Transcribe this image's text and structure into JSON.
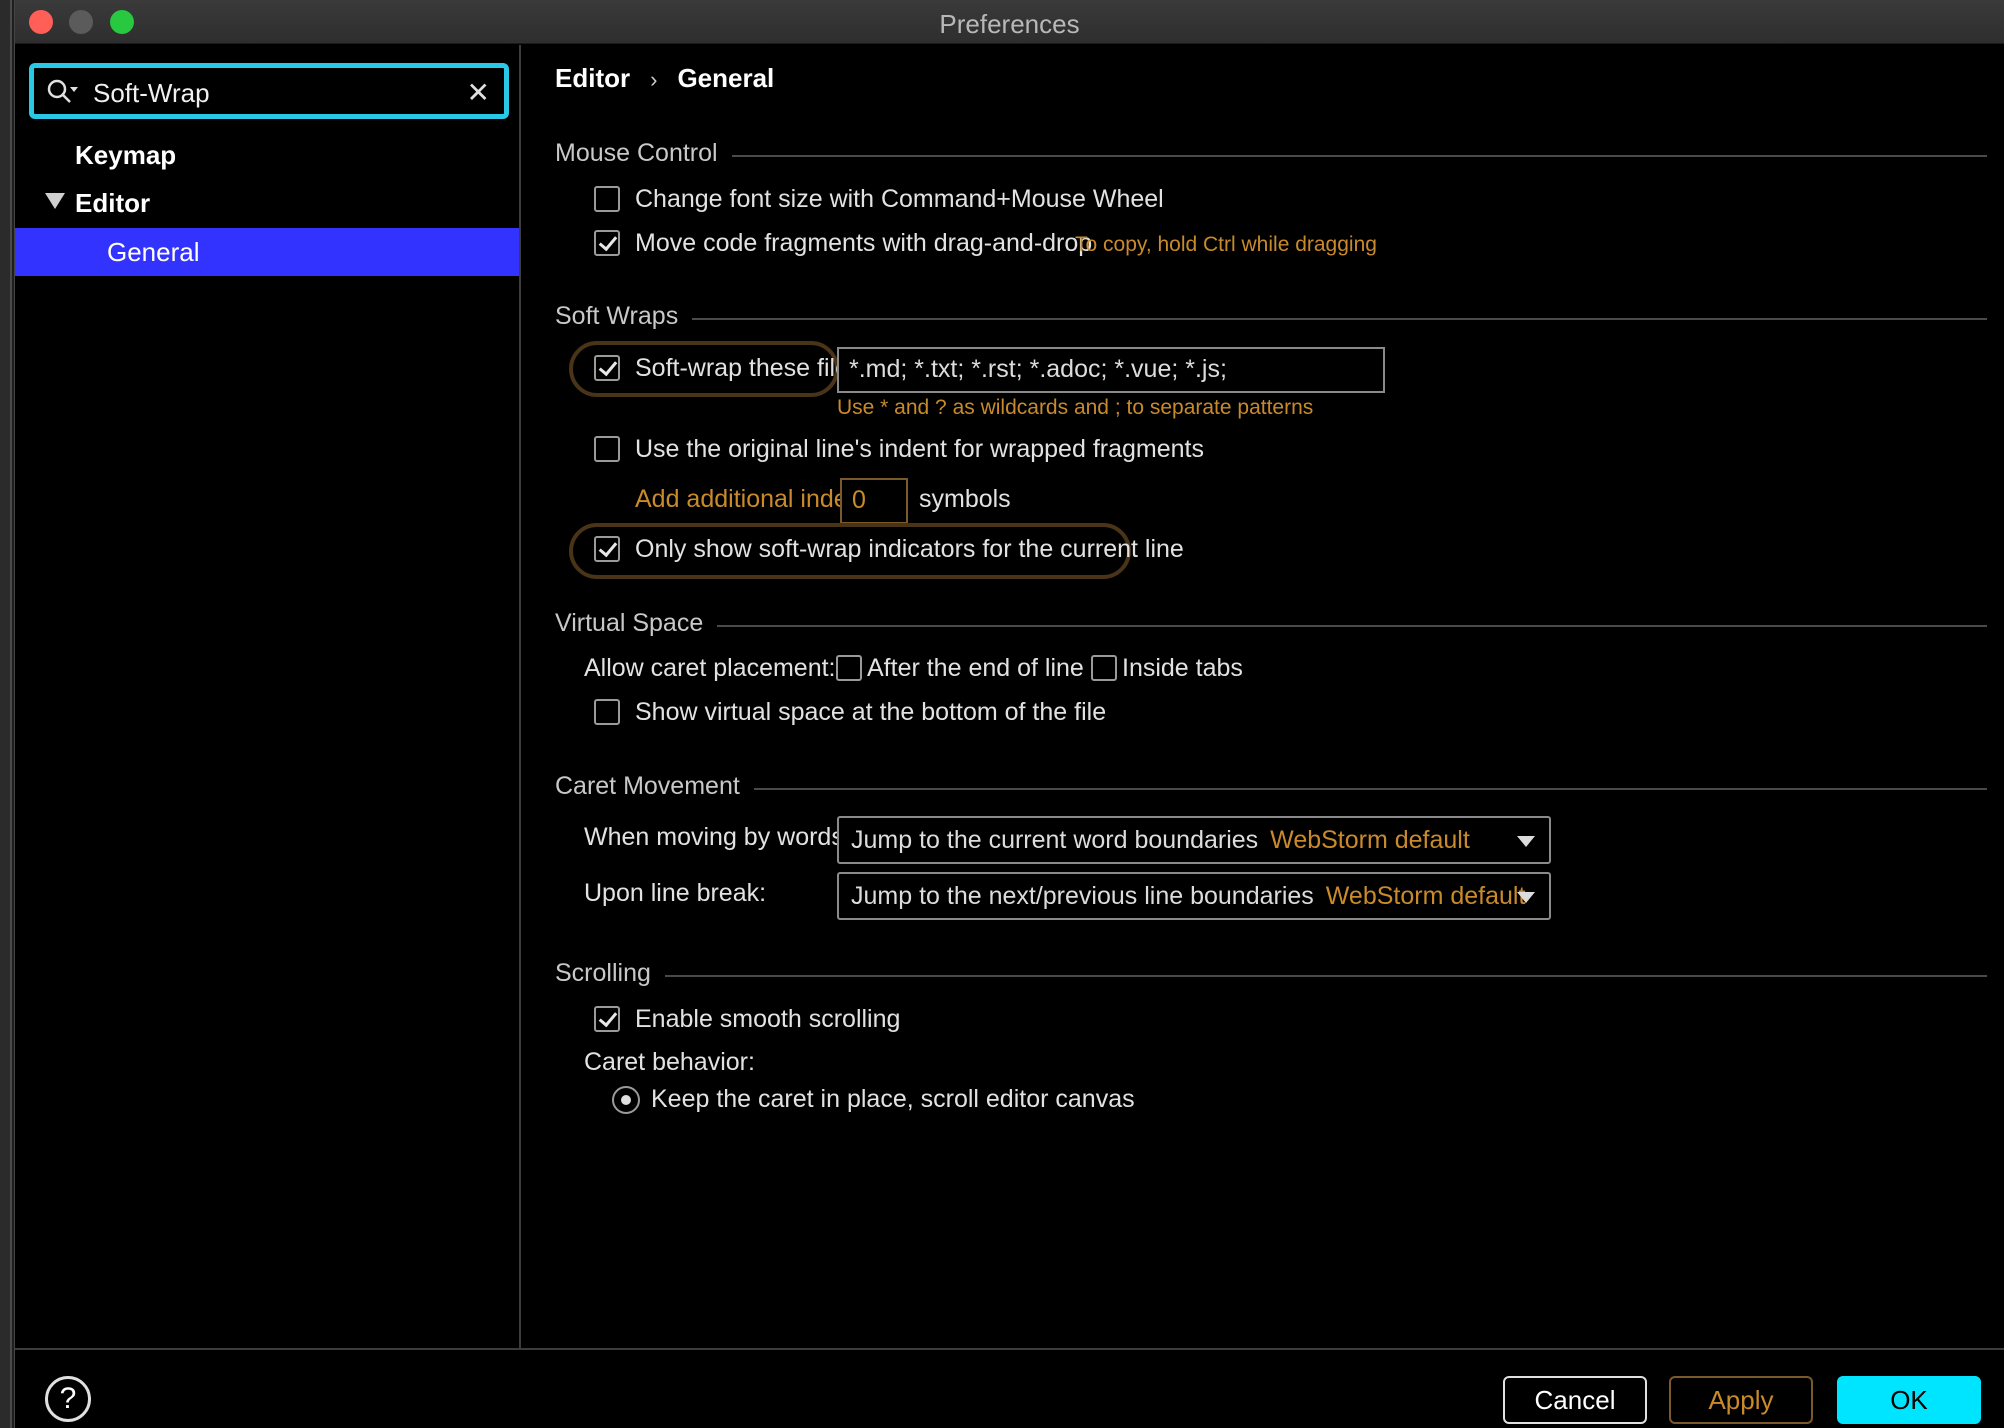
{
  "window": {
    "title": "Preferences"
  },
  "search": {
    "value": "Soft-Wrap"
  },
  "tree": {
    "keymap": "Keymap",
    "editor": "Editor",
    "general": "General"
  },
  "breadcrumb": {
    "parent": "Editor",
    "sep": "›",
    "current": "General"
  },
  "mouse_control": {
    "title": "Mouse Control",
    "change_font": {
      "label": "Change font size with Command+Mouse Wheel",
      "checked": false
    },
    "move_code": {
      "label": "Move code fragments with drag-and-drop",
      "checked": true,
      "hint": "To copy, hold Ctrl while dragging"
    }
  },
  "soft_wraps": {
    "title": "Soft Wraps",
    "soft_wrap_files": {
      "label": "Soft-wrap these files:",
      "checked": true,
      "value": "*.md; *.txt; *.rst; *.adoc; *.vue; *.js;",
      "hint": "Use * and ? as wildcards and ; to separate patterns"
    },
    "original_indent": {
      "label": "Use the original line's indent for wrapped fragments",
      "checked": false
    },
    "additional_indent": {
      "label": "Add additional indent:",
      "value": "0",
      "unit": "symbols"
    },
    "only_current_line": {
      "label": "Only show soft-wrap indicators for the current line",
      "checked": true
    }
  },
  "virtual_space": {
    "title": "Virtual Space",
    "caret_label": "Allow caret placement:",
    "after_end": {
      "label": "After the end of line",
      "checked": false
    },
    "inside_tabs": {
      "label": "Inside tabs",
      "checked": false
    },
    "show_bottom": {
      "label": "Show virtual space at the bottom of the file",
      "checked": false
    }
  },
  "caret_movement": {
    "title": "Caret Movement",
    "words_label": "When moving by words:",
    "words_value": "Jump to the current word boundaries",
    "words_default": "WebStorm default",
    "linebreak_label": "Upon line break:",
    "linebreak_value": "Jump to the next/previous line boundaries",
    "linebreak_default": "WebStorm default"
  },
  "scrolling": {
    "title": "Scrolling",
    "smooth": {
      "label": "Enable smooth scrolling",
      "checked": true
    },
    "caret_behavior": "Caret behavior:",
    "keep_caret": "Keep the caret in place, scroll editor canvas"
  },
  "footer": {
    "help": "?",
    "cancel": "Cancel",
    "apply": "Apply",
    "ok": "OK"
  },
  "colors": {
    "accent": "#29c8e6",
    "selection": "#3333ff",
    "hint": "#c98a2b",
    "ok": "#00e5ff"
  }
}
